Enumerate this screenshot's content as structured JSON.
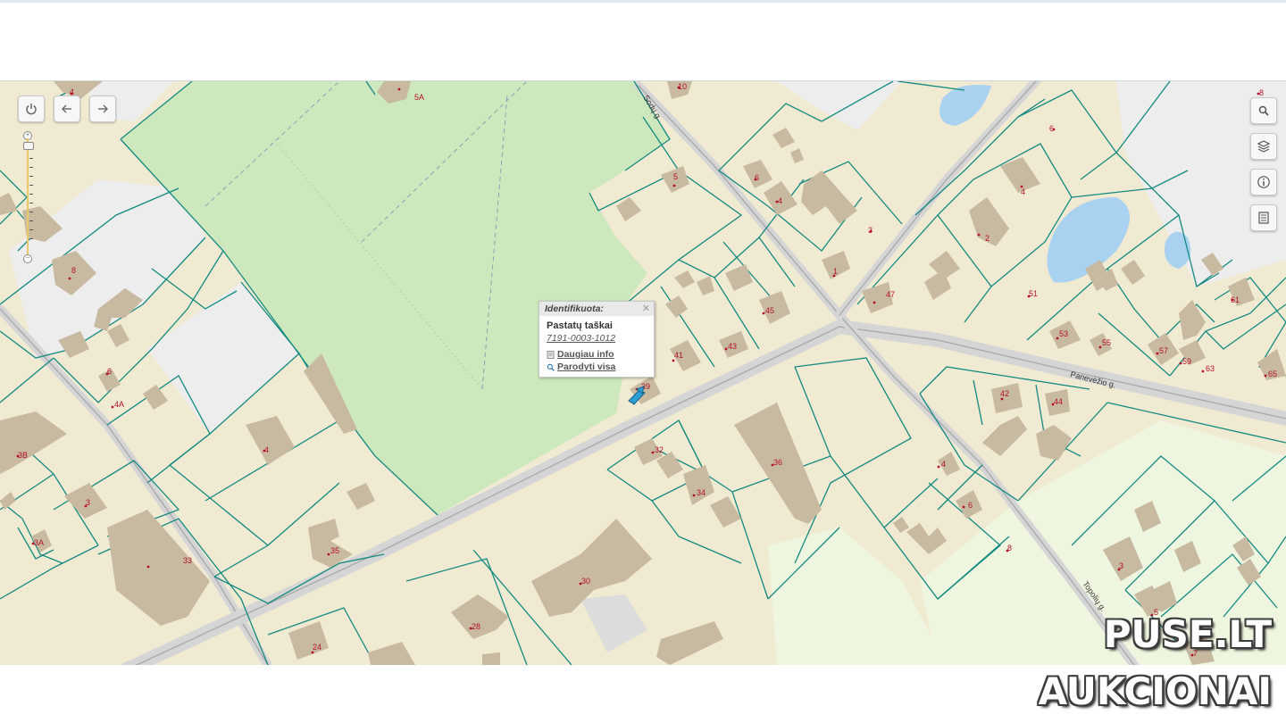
{
  "colors": {
    "ground": "#f1ead3",
    "forest": "#cde8bd",
    "light_green": "#eef6df",
    "grey_area": "#ededed",
    "water": "#a9d2f1",
    "parcel_line": "#138a80",
    "building": "#c8b9a1",
    "road": "#d5d5d5",
    "label": "#b4112a"
  },
  "toolbar": {
    "power_icon": "power-icon",
    "back_icon": "arrow-left-icon",
    "forward_icon": "arrow-right-icon"
  },
  "right_tools": [
    {
      "icon": "search-icon"
    },
    {
      "icon": "layers-icon"
    },
    {
      "icon": "info-icon"
    },
    {
      "icon": "legend-icon"
    }
  ],
  "popup": {
    "title": "Identifikuota:",
    "layer": "Pastatų taškai",
    "object_id": "7191-0003-1012",
    "more_info": "Daugiau info",
    "show_all": "Parodyti visa"
  },
  "streets": {
    "sodu": "Sodų g.",
    "panevezio": "Panevėžio g.",
    "topoliu": "Topolių g."
  },
  "labels": [
    "5A",
    "4",
    "10",
    "8",
    "5",
    "6",
    "4",
    "3",
    "6",
    "4",
    "2",
    "51",
    "47",
    "1",
    "45",
    "43",
    "41",
    "39",
    "8",
    "6",
    "4A",
    "3B",
    "4",
    "3",
    "3A",
    "33",
    "35",
    "42",
    "44",
    "53",
    "55",
    "57",
    "59",
    "63",
    "65",
    "61",
    "32",
    "34",
    "36",
    "4",
    "6",
    "8",
    "3",
    "5",
    "7",
    "30",
    "28",
    "24"
  ],
  "watermark": {
    "line1": "PUSE.LT",
    "line2": "AUKCIONAI"
  }
}
